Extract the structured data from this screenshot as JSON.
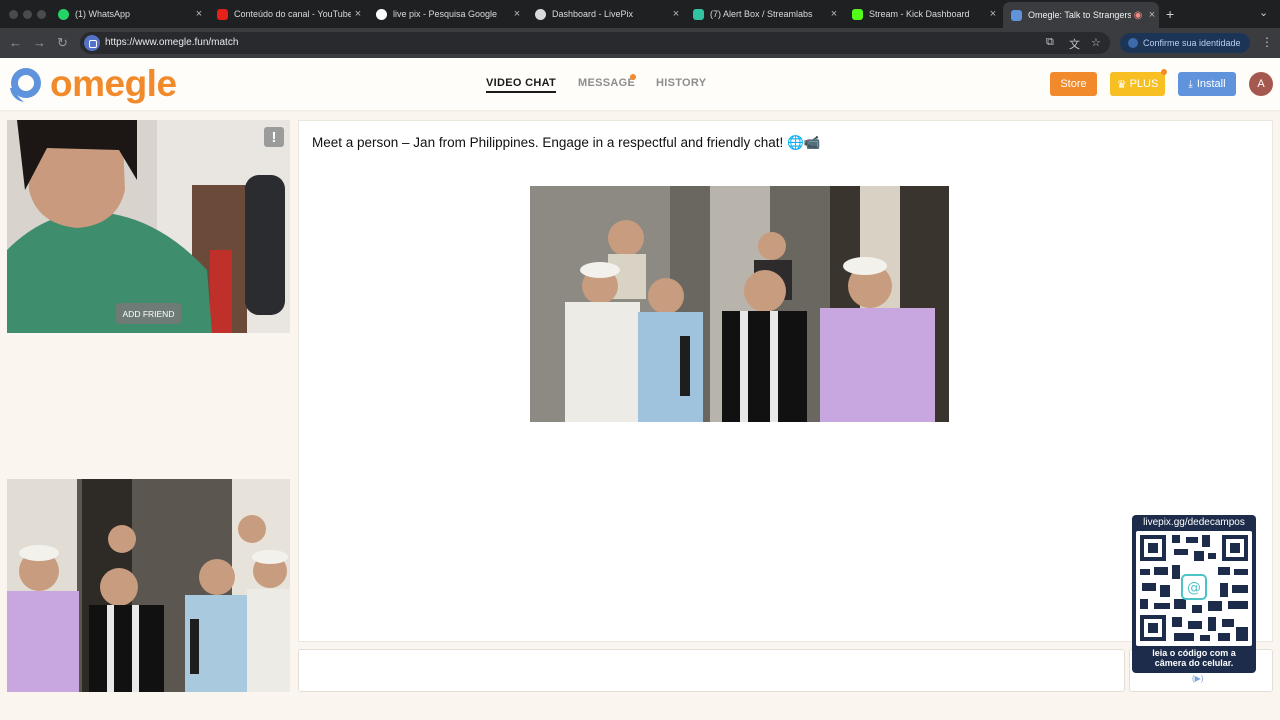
{
  "browser": {
    "tabs": [
      {
        "label": "(1) WhatsApp",
        "icon": "whatsapp-icon",
        "color": "#25d366"
      },
      {
        "label": "Conteúdo do canal - YouTube",
        "icon": "youtube-icon",
        "color": "#e62117"
      },
      {
        "label": "live pix - Pesquisa Google",
        "icon": "google-icon",
        "color": "#d9dadc"
      },
      {
        "label": "Dashboard - LivePix",
        "icon": "livepix-icon",
        "color": "#d9dadc"
      },
      {
        "label": "(7) Alert Box / Streamlabs",
        "icon": "streamlabs-icon",
        "color": "#31c3a2"
      },
      {
        "label": "Stream - Kick Dashboard",
        "icon": "kick-icon",
        "color": "#53fc18"
      },
      {
        "label": "Omegle: Talk to Strangers!",
        "icon": "omegle-icon",
        "color": "#5f94dd"
      }
    ],
    "url": "https://www.omegle.fun/match",
    "profile_label": "Confirme sua identidade"
  },
  "site": {
    "logo_text": "omegle",
    "nav": {
      "video_chat": "VIDEO CHAT",
      "message": "MESSAGE",
      "history": "HISTORY"
    },
    "buttons": {
      "store": "Store",
      "plus": "PLUS",
      "install": "Install"
    },
    "avatar_letter": "A"
  },
  "video": {
    "add_friend": "ADD FRIEND",
    "report": "!"
  },
  "chat": {
    "message": "Meet a person – Jan from Philippines. Engage in a respectful and friendly chat! 🌐📹"
  },
  "overlay": {
    "qr_url": "livepix.gg/dedecampos",
    "qr_caption_line1": "leia o código com a",
    "qr_caption_line2": "câmera do celular."
  },
  "colors": {
    "brand": "#f08a2b",
    "plus": "#f7bf22",
    "install": "#5f94dd"
  }
}
